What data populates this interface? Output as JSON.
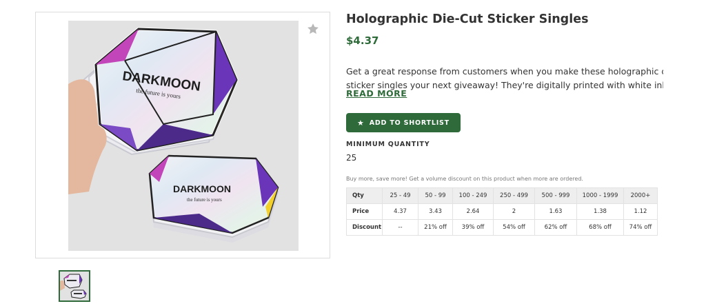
{
  "product": {
    "title": "Holographic Die-Cut Sticker Singles",
    "price": "$4.37",
    "description_line1": "Get a great response from customers when you make these holographic die-cut",
    "description_line2": "sticker singles your next giveaway! They're digitally printed with white ink and mad...",
    "read_more_label": "READ MORE",
    "shortlist_label": "ADD TO SHORTLIST",
    "min_quantity_label": "MINIMUM QUANTITY",
    "min_quantity_value": "25",
    "volume_note": "Buy more, save more! Get a volume discount on this product when more are ordered."
  },
  "image": {
    "brand": "DARKMOON",
    "tagline": "the future is yours",
    "favorite_icon": "star-icon"
  },
  "pricing": {
    "qty_label": "Qty",
    "price_label": "Price",
    "discount_label": "Discount",
    "tiers": [
      "25 - 49",
      "50 - 99",
      "100 - 249",
      "250 - 499",
      "500 - 999",
      "1000 - 1999",
      "2000+"
    ],
    "prices": [
      "4.37",
      "3.43",
      "2.64",
      "2",
      "1.63",
      "1.38",
      "1.12"
    ],
    "discounts": [
      "--",
      "21% off",
      "39% off",
      "54% off",
      "62% off",
      "68% off",
      "74% off"
    ]
  },
  "colors": {
    "accent": "#2f6b3a",
    "table_header": "#eeeeee"
  }
}
